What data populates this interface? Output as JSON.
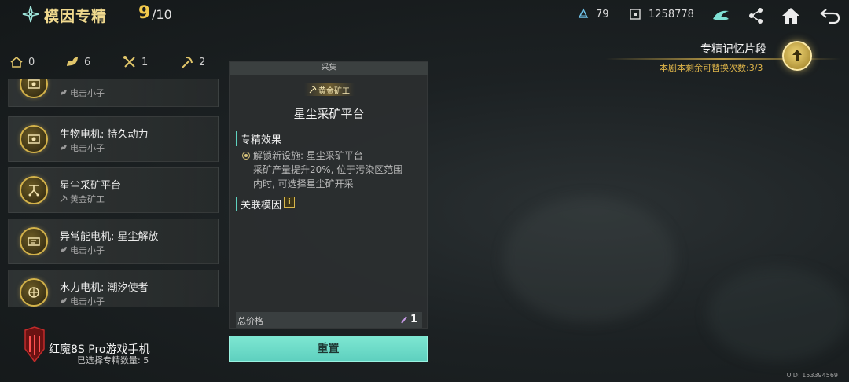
{
  "header": {
    "title": "模因专精",
    "counter_current": "9",
    "counter_total": "/10",
    "resource_1": "79",
    "resource_2": "1258778"
  },
  "tabs": [
    {
      "icon": "house-icon",
      "count": "0"
    },
    {
      "icon": "leaf-icon",
      "count": "6"
    },
    {
      "icon": "crossed-tools-icon",
      "count": "1"
    },
    {
      "icon": "pickaxe-icon",
      "count": "2"
    }
  ],
  "list": {
    "items": [
      {
        "name": "",
        "sub": "电击小子",
        "sub_icon": "leaf-icon"
      },
      {
        "name": "生物电机: 持久动力",
        "sub": "电击小子",
        "sub_icon": "leaf-icon"
      },
      {
        "name": "星尘采矿平台",
        "sub": "黄金矿工",
        "sub_icon": "pickaxe-icon"
      },
      {
        "name": "异常能电机: 星尘解放",
        "sub": "电击小子",
        "sub_icon": "leaf-icon"
      },
      {
        "name": "水力电机: 潮汐使者",
        "sub": "电击小子",
        "sub_icon": "leaf-icon"
      }
    ]
  },
  "panel": {
    "category": "采集",
    "badge": "黄金矿工",
    "title": "星尘采矿平台",
    "effect_heading": "专精效果",
    "effect_line_1": "解锁新设施: 星尘采矿平台",
    "effect_line_2": "采矿产量提升20%, 位于污染区范围",
    "effect_line_3": "内时, 可选择星尘矿开采",
    "related_heading": "关联模因",
    "info_glyph": "i",
    "price_label": "总价格",
    "price_value": "1",
    "reset_label": "重置"
  },
  "memory": {
    "title": "专精记忆片段",
    "subtitle": "本剧本剩余可替换次数:3/3"
  },
  "footer": {
    "device": "红魔8S Pro游戏手机",
    "selected_count": "已选择专精数量: 5",
    "uid": "UID: 153394569"
  },
  "colors": {
    "accent_teal": "#5fd0bf",
    "gold": "#f2c94c",
    "background": "#1c2123"
  }
}
